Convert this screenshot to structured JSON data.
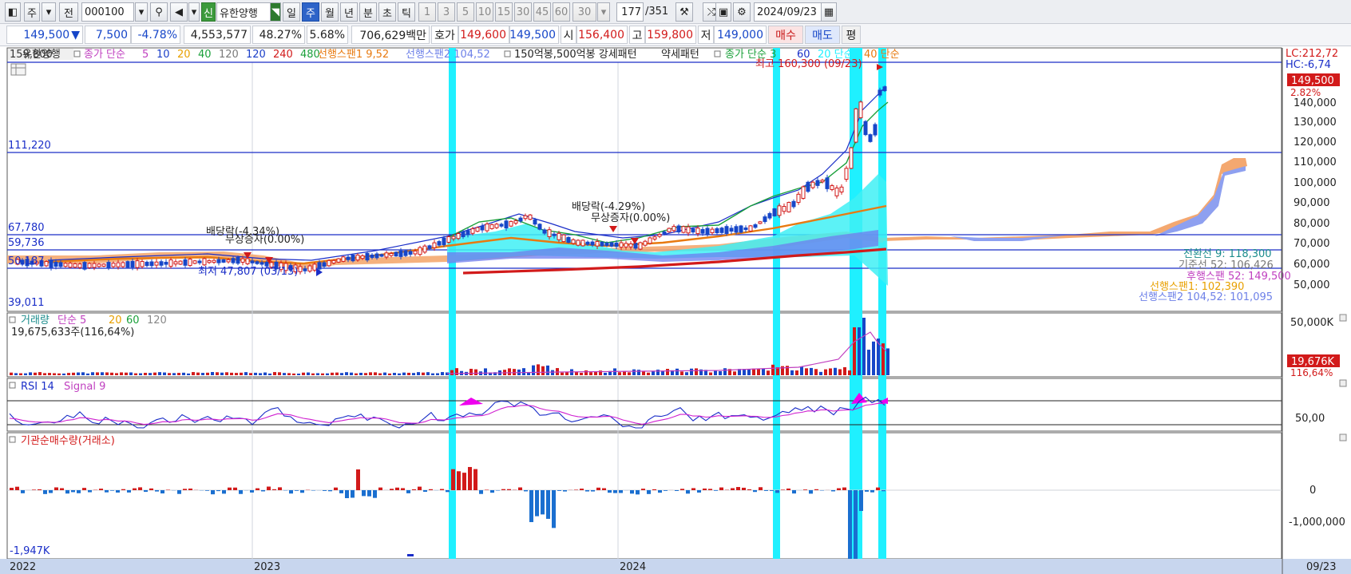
{
  "toolbar": {
    "period_selected": "주",
    "prev_label": "전",
    "code": "000100",
    "badge_new": "신",
    "stock_name": "유한양행",
    "periods": [
      "일",
      "주",
      "월",
      "년",
      "분",
      "초",
      "틱"
    ],
    "active_period": "주",
    "intervals": [
      "1",
      "3",
      "5",
      "10",
      "15",
      "30",
      "45",
      "60"
    ],
    "interval_value": "30",
    "count": "177",
    "total": "/351",
    "date": "2024/09/23"
  },
  "quote": {
    "price": "149,500",
    "arrow": "▼",
    "change": "7,500",
    "change_pct": "-4.78%",
    "volume": "4,553,577",
    "vol_ratio": "48.27%",
    "turnover": "5.68%",
    "amount": "706,629백만",
    "ask_label": "호가",
    "ask": "149,600",
    "bid": "149,500",
    "open_label": "시",
    "open": "156,400",
    "high_label": "고",
    "high": "159,800",
    "low_label": "저",
    "low": "149,000",
    "buy_btn": "매수",
    "sell_btn": "매도",
    "eval_btn": "평"
  },
  "price_panel": {
    "legend_name": "유한양행",
    "legend_close": "종가 단순",
    "ma_periods": [
      {
        "label": "5",
        "color": "#c040c0"
      },
      {
        "label": "10",
        "color": "#1a3ec8"
      },
      {
        "label": "20",
        "color": "#e8a000"
      },
      {
        "label": "40",
        "color": "#1aa03a"
      },
      {
        "label": "120",
        "color": "#7a7a7a"
      },
      {
        "label": "120",
        "color": "#1a3ec8"
      },
      {
        "label": "240",
        "color": "#d21a1a"
      },
      {
        "label": "480",
        "color": "#1aa03a"
      }
    ],
    "span1": "선행스팬1 9,52",
    "span2": "선행스팬2 104,52",
    "pattern_label": "150억봉,500억봉 강세패턴",
    "weak_label": "약세패턴",
    "close_simple2": "종가 단순 3",
    "p60": "60",
    "p20": "20 단순",
    "p40": "40 단순",
    "top_left_value": "159,800",
    "lc": "LC:212,72",
    "hc": "HC:-6,74",
    "current_price_tag": "149,500",
    "current_pct_tag": "2.82%",
    "high_annot": "최고 160,300 (09/23)",
    "low_annot": "최저 47,807 (03/13)",
    "div1": "배당락(-4.34%)",
    "bonus1": "무상증자(0.00%)",
    "div2": "배당락(-4.29%)",
    "bonus2": "무상증자(0.00%)",
    "hlines": [
      "111,220",
      "67,780",
      "59,736",
      "50,187",
      "39,011"
    ],
    "y_ticks": [
      "140,000",
      "130,000",
      "120,000",
      "110,000",
      "100,000",
      "90,000",
      "80,000",
      "70,000",
      "60,000",
      "50,000"
    ],
    "ichimoku": [
      "전환선 9: 118,300",
      "기준선 52: 106,426",
      "후행스팬 52: 149,500",
      "선행스팬1: 102,390",
      "선행스팬2 104,52: 101,095"
    ]
  },
  "volume_panel": {
    "title": "거래량",
    "legend": "단순 5",
    "p20": "20",
    "p60": "60",
    "p120": "120",
    "value": "19,675,633주(116,64%)",
    "y_top": "50,000K",
    "tag": "19,676K",
    "tag_pct": "116,64%"
  },
  "rsi_panel": {
    "title": "RSI 14",
    "signal": "Signal 9",
    "y_label": "50,00"
  },
  "inst_panel": {
    "title": "기관순매수량(거래소)",
    "y_zero": "0",
    "y_neg": "-1,000,000",
    "min_label": "-1,947K"
  },
  "x_axis": {
    "labels": [
      "2022",
      "2023",
      "2024"
    ],
    "right_date": "09/23"
  },
  "colors": {
    "up": "#d21a1a",
    "down": "#1646c8",
    "highlight": "#1ff0ff",
    "cloud_up": "#f4a870",
    "cloud_down": "#7b8cf0",
    "aqua_fill": "#3ff0f5"
  }
}
